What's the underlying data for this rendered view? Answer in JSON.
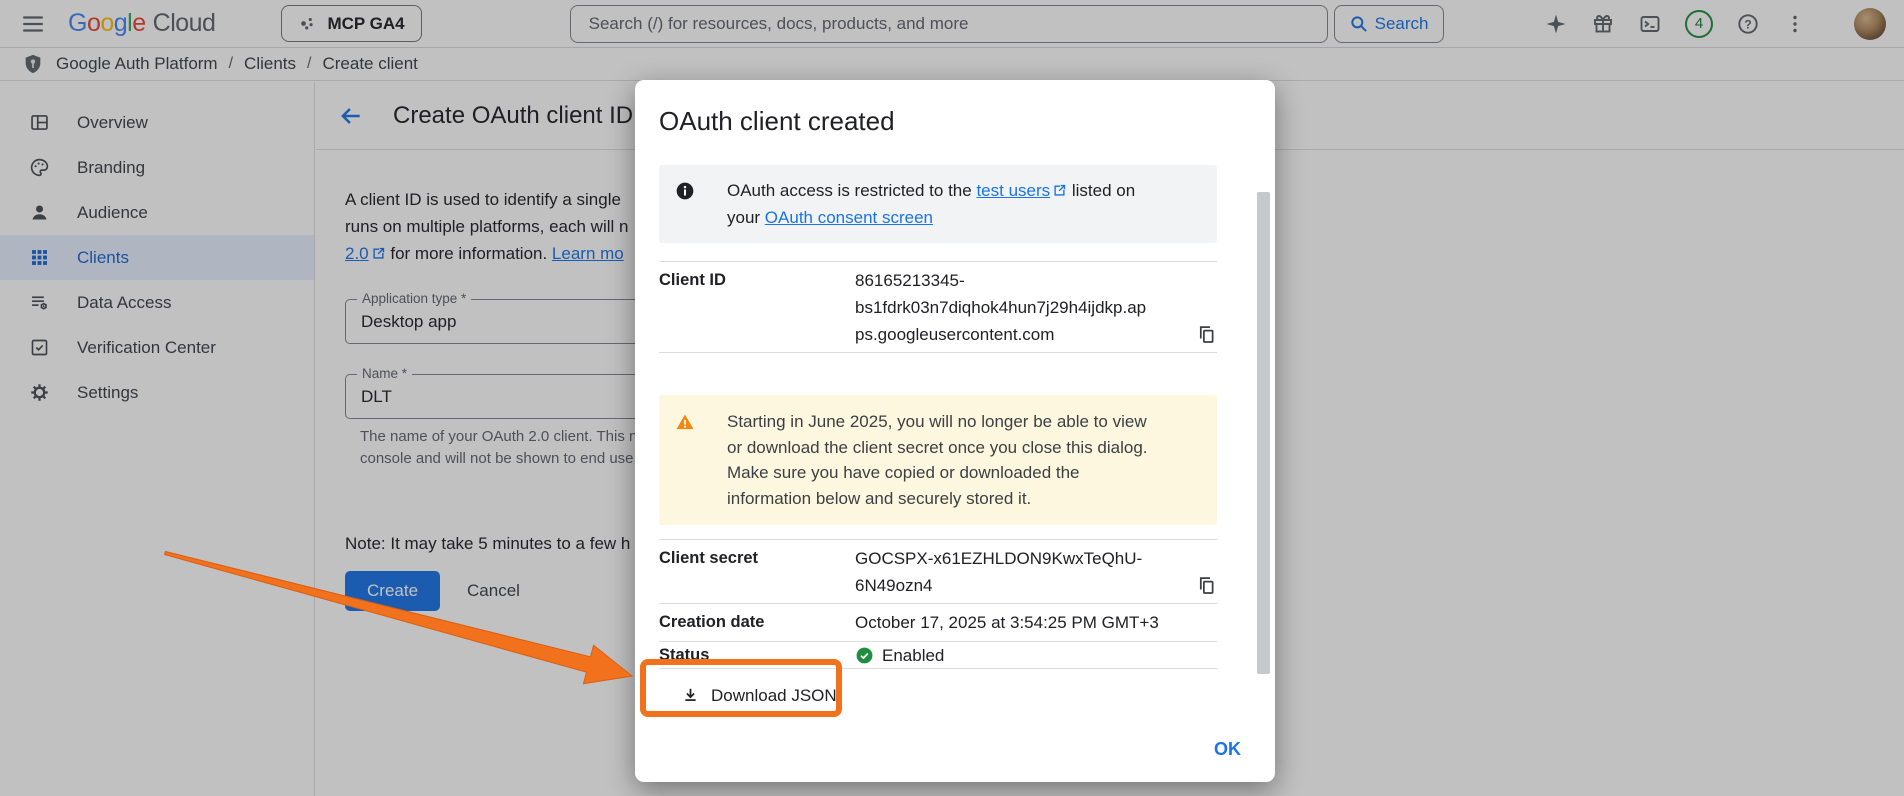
{
  "topbar": {
    "logo": {
      "letters": [
        "G",
        "o",
        "o",
        "g",
        "l",
        "e"
      ],
      "cloud": "Cloud"
    },
    "project_selector": "MCP GA4",
    "search_placeholder": "Search (/) for resources, docs, products, and more",
    "search_button_label": "Search",
    "notification_count": "4",
    "icons": [
      "menu-icon",
      "gemini-sparkle-icon",
      "gift-icon",
      "cloud-shell-icon",
      "notification-count-badge",
      "help-icon",
      "more-vert-icon",
      "avatar"
    ]
  },
  "breadcrumb": {
    "icon": "auth-platform-shield-icon",
    "items": [
      "Google Auth Platform",
      "Clients",
      "Create client"
    ],
    "separator": "/"
  },
  "sidebar": {
    "items": [
      {
        "label": "Overview",
        "icon": "overview-icon",
        "selected": false
      },
      {
        "label": "Branding",
        "icon": "palette-icon",
        "selected": false
      },
      {
        "label": "Audience",
        "icon": "audience-icon",
        "selected": false
      },
      {
        "label": "Clients",
        "icon": "grid-icon",
        "selected": true
      },
      {
        "label": "Data Access",
        "icon": "data-access-icon",
        "selected": false
      },
      {
        "label": "Verification Center",
        "icon": "verification-icon",
        "selected": false
      },
      {
        "label": "Settings",
        "icon": "gear-icon",
        "selected": false
      }
    ]
  },
  "content": {
    "title": "Create OAuth client ID",
    "intro": {
      "line1": "A client ID is used to identify a single",
      "line2": "runs on multiple platforms, each will n",
      "line3_link1": "2.0",
      "line3_mid": " for more information. ",
      "line3_link2": "Learn mo"
    },
    "fields": {
      "application_type": {
        "label": "Application type *",
        "value": "Desktop app"
      },
      "name": {
        "label": "Name *",
        "value": "DLT"
      }
    },
    "name_helper_line1": "The name of your OAuth 2.0 client. This n",
    "name_helper_line2": "console and will not be shown to end use",
    "note": "Note: It may take 5 minutes to a few h",
    "create_button": "Create",
    "cancel_button": "Cancel"
  },
  "dialog": {
    "title": "OAuth client created",
    "banner": {
      "line1_prefix": "OAuth access is restricted to the ",
      "link1": "test users",
      "line1_suffix": " listed on",
      "line2_prefix": "your ",
      "link2": "OAuth consent screen"
    },
    "client_id": {
      "label": "Client ID",
      "value": "86165213345-bs1fdrk03n7diqhok4hun7j29h4ijdkp.apps.googleusercontent.com",
      "lines": [
        "86165213345-",
        "bs1fdrk03n7diqhok4hun7j29h4ijdkp.ap",
        "ps.googleusercontent.com"
      ]
    },
    "warning_lines": [
      "Starting in June 2025, you will no longer be able to view",
      "or download the client secret once you close this dialog.",
      "Make sure you have copied or downloaded the",
      "information below and securely stored it."
    ],
    "client_secret": {
      "label": "Client secret",
      "value": "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",
      "lines": [
        "GOCSPX-x61EZHLDON9KwxTeQhU-",
        "6N49ozn4"
      ]
    },
    "creation_date": {
      "label": "Creation date",
      "value": "October 17, 2025 at 3:54:25 PM GMT+3"
    },
    "status": {
      "label": "Status",
      "value": "Enabled"
    },
    "download_button": "Download JSON",
    "ok_button": "OK"
  },
  "annotation": {
    "color": "#f2711c",
    "target": "Download JSON button"
  },
  "colors": {
    "accent_blue": "#1a73e8",
    "text_primary": "#202124",
    "text_secondary": "#5f6368",
    "warning_bg": "#fef7e0",
    "info_bg": "#f1f3f4",
    "success_green": "#1e8e3e",
    "annotation_orange": "#f2711c"
  }
}
